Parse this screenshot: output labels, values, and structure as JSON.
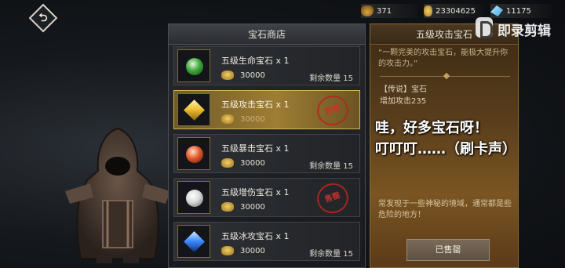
{
  "currency": {
    "stamina": "371",
    "gold": "23304625",
    "crystal": "11175"
  },
  "back_label": "⮌",
  "shop": {
    "title": "宝石商店",
    "items": [
      {
        "name": "五级生命宝石 x 1",
        "price": "30000",
        "stock": "剩余数量 15",
        "gem_color": "#3ca83a",
        "gem_shape": "round",
        "sold": false
      },
      {
        "name": "五级攻击宝石 x 1",
        "price": "30000",
        "stock": "",
        "gem_color": "#f2c233",
        "gem_shape": "cube",
        "sold": true
      },
      {
        "name": "五级暴击宝石 x 1",
        "price": "30000",
        "stock": "剩余数量 15",
        "gem_color": "#e2572a",
        "gem_shape": "round",
        "sold": false
      },
      {
        "name": "五级增伤宝石 x 1",
        "price": "30000",
        "stock": "",
        "gem_color": "#d8d8d8",
        "gem_shape": "round",
        "sold": true
      },
      {
        "name": "五级冰攻宝石 x 1",
        "price": "30000",
        "stock": "剩余数量 15",
        "gem_color": "#3f8dff",
        "gem_shape": "cube",
        "sold": false
      }
    ],
    "sold_stamp": "售罄"
  },
  "detail": {
    "title": "五级攻击宝石",
    "description": "“一颗完美的攻击宝石，能极大提升你的攻击力。”",
    "stat_line1": "【传说】宝石",
    "stat_line2": "增加攻击235",
    "flavor": "常发现于一些神秘的境域，通常都是些危险的地方！",
    "button": "已售罄"
  },
  "caption": {
    "line1": "哇，好多宝石呀！",
    "line2": "叮叮叮……（刷卡声）"
  },
  "watermark": {
    "text": "即录剪辑"
  },
  "colors": {
    "accent_gold": "#d2b25a",
    "stamp_red": "#b3281f"
  }
}
